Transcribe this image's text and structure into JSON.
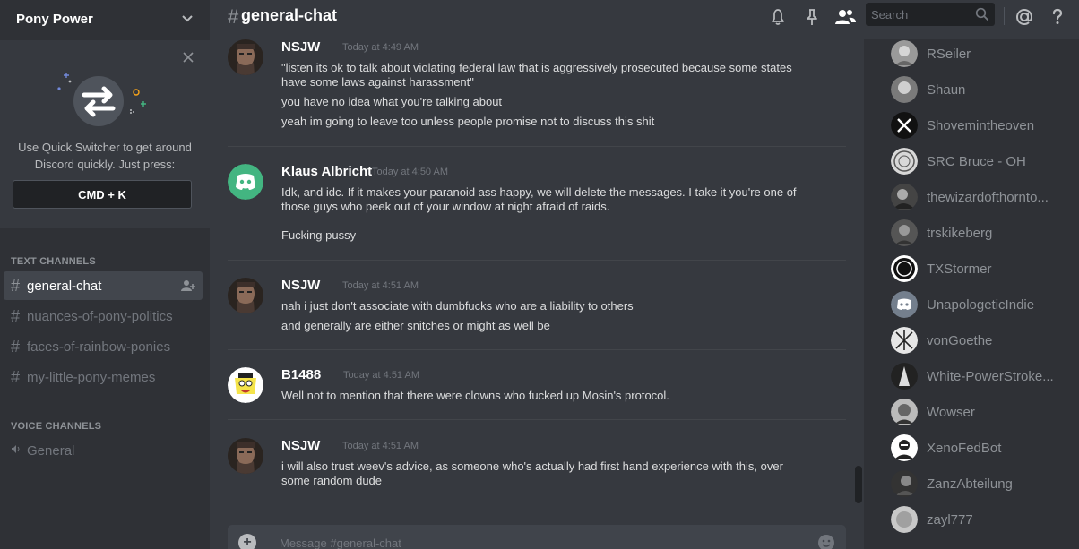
{
  "server": {
    "name": "Pony Power"
  },
  "quick_switcher": {
    "text": "Use Quick Switcher to get around Discord quickly. Just press:",
    "shortcut": "CMD + K"
  },
  "categories": {
    "text": "TEXT CHANNELS",
    "voice": "VOICE CHANNELS"
  },
  "text_channels": [
    {
      "name": "general-chat",
      "active": true
    },
    {
      "name": "nuances-of-pony-politics"
    },
    {
      "name": "faces-of-rainbow-ponies"
    },
    {
      "name": "my-little-pony-memes"
    }
  ],
  "voice_channels": [
    {
      "name": "General"
    }
  ],
  "header": {
    "hash": "#",
    "channel": "general-chat",
    "search_placeholder": "Search",
    "icons": [
      "bell-icon",
      "pin-icon",
      "members-icon",
      "search-icon",
      "mention-icon",
      "help-icon"
    ]
  },
  "messages": [
    {
      "author": "NSJW",
      "timestamp": "Today at 4:49 AM",
      "avatar": "photo-avatar",
      "lines": [
        "\"listen its ok to talk about violating federal law that is aggressively prosecuted because some states have some laws against harassment\"",
        "you have no idea what you're talking about",
        "yeah im going to leave too unless people promise not to discuss this shit"
      ]
    },
    {
      "author": "Klaus Albricht",
      "timestamp": "Today at 4:50 AM",
      "avatar": "discord-default-avatar",
      "lines": [
        "Idk, and idc. If it makes your paranoid ass happy, we will delete the messages. I take it you're one of those guys who peek out of your window at night afraid of raids.",
        "Fucking pussy"
      ]
    },
    {
      "author": "NSJW",
      "timestamp": "Today at 4:51 AM",
      "avatar": "photo-avatar",
      "lines": [
        "nah i just don't associate with dumbfucks who are a liability to others",
        "and generally are either snitches or might as well be"
      ]
    },
    {
      "author": "B1488",
      "timestamp": "Today at 4:51 AM",
      "avatar": "cartoon-avatar",
      "lines": [
        "Well not to mention that there were clowns who fucked up Mosin's protocol."
      ]
    },
    {
      "author": "NSJW",
      "timestamp": "Today at 4:51 AM",
      "avatar": "photo-avatar",
      "lines": [
        "i will also trust weev's advice, as someone who's actually had first hand experience with this, over some random dude"
      ]
    }
  ],
  "composer": {
    "placeholder": "Message #general-chat"
  },
  "members": [
    "RSeiler",
    "Shaun",
    "Shovemintheoven",
    "SRC Bruce - OH",
    "thewizardofthornto...",
    "trskikeberg",
    "TXStormer",
    "UnapologeticIndie",
    "vonGoethe",
    "White-PowerStroke...",
    "Wowser",
    "XenoFedBot",
    "ZanzAbteilung",
    "zayl777"
  ],
  "colors": {
    "background": "#36393f",
    "sidebar": "#2f3136",
    "blurple": "#43b581",
    "text": "#dcddde"
  }
}
